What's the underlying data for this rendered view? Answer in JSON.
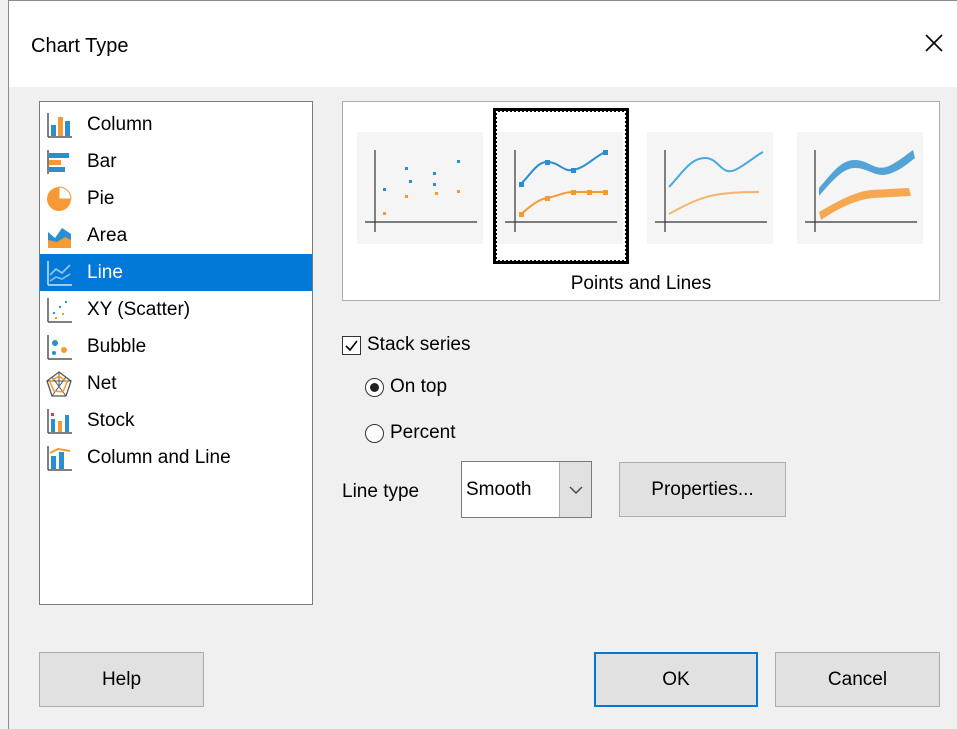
{
  "window": {
    "title": "Chart Type"
  },
  "chart_types": [
    {
      "label": "Column",
      "icon": "column-chart-icon"
    },
    {
      "label": "Bar",
      "icon": "bar-chart-icon"
    },
    {
      "label": "Pie",
      "icon": "pie-chart-icon"
    },
    {
      "label": "Area",
      "icon": "area-chart-icon"
    },
    {
      "label": "Line",
      "icon": "line-chart-icon",
      "selected": true
    },
    {
      "label": "XY (Scatter)",
      "icon": "scatter-chart-icon"
    },
    {
      "label": "Bubble",
      "icon": "bubble-chart-icon"
    },
    {
      "label": "Net",
      "icon": "net-chart-icon"
    },
    {
      "label": "Stock",
      "icon": "stock-chart-icon"
    },
    {
      "label": "Column and Line",
      "icon": "column-line-chart-icon"
    }
  ],
  "variants": {
    "selected_index": 1,
    "selected_caption": "Points and Lines",
    "items": [
      "points-only",
      "points-and-lines",
      "lines-only",
      "3d-lines"
    ]
  },
  "options": {
    "stack_series": {
      "label": "Stack series",
      "checked": true
    },
    "on_top": {
      "label": "On top",
      "selected": true
    },
    "percent": {
      "label": "Percent",
      "selected": false
    }
  },
  "line_type": {
    "label": "Line type",
    "value": "Smooth"
  },
  "buttons": {
    "properties": "Properties...",
    "help": "Help",
    "ok": "OK",
    "cancel": "Cancel"
  },
  "colors": {
    "selection": "#0078d7",
    "series_blue": "#2a8fd0",
    "series_orange": "#f59a34"
  }
}
